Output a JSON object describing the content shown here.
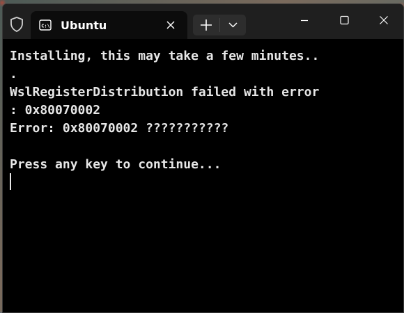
{
  "window": {
    "tab": {
      "title": "Ubuntu",
      "icon": "terminal-icon"
    },
    "buttons": {
      "new_tab_icon": "plus-icon",
      "dropdown_icon": "chevron-down-icon",
      "minimize_icon": "minimize-icon",
      "maximize_icon": "maximize-icon",
      "close_icon": "close-icon"
    }
  },
  "terminal": {
    "lines": [
      "Installing, this may take a few minutes..",
      ".",
      "WslRegisterDistribution failed with error",
      ": 0x80070002",
      "Error: 0x80070002 ???????????",
      "",
      "Press any key to continue..."
    ]
  },
  "colors": {
    "titlebar": "#1f1f1f",
    "terminal_bg": "#000000",
    "terminal_fg": "#e6e6e6"
  }
}
